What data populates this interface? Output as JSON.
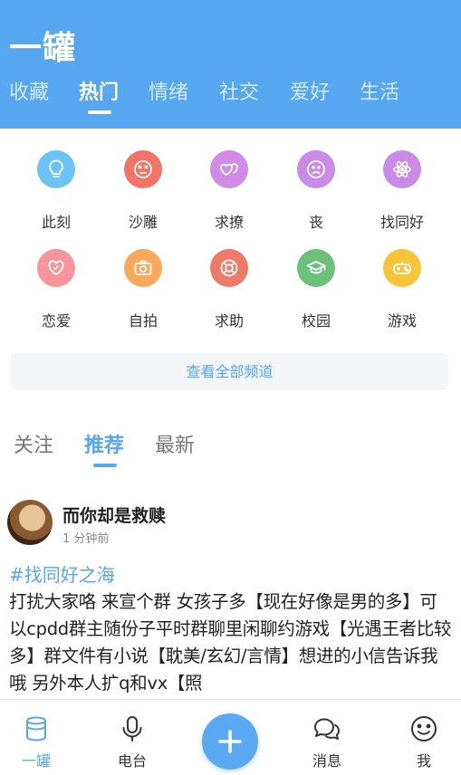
{
  "app": {
    "title": "一罐"
  },
  "top_tabs": [
    {
      "label": "收藏",
      "active": false
    },
    {
      "label": "热门",
      "active": true
    },
    {
      "label": "情绪",
      "active": false
    },
    {
      "label": "社交",
      "active": false
    },
    {
      "label": "爱好",
      "active": false
    },
    {
      "label": "生活",
      "active": false
    }
  ],
  "channels": [
    {
      "label": "此刻",
      "icon": "lightbulb-icon",
      "color": "#6cc3f5"
    },
    {
      "label": "沙雕",
      "icon": "dizzy-face-icon",
      "color": "#f17466"
    },
    {
      "label": "求撩",
      "icon": "hearts-icon",
      "color": "#d08ae8"
    },
    {
      "label": "丧",
      "icon": "sad-face-icon",
      "color": "#c98ae8"
    },
    {
      "label": "找同好",
      "icon": "atom-icon",
      "color": "#c98ae8"
    },
    {
      "label": "恋爱",
      "icon": "heart-icon",
      "color": "#f7959a"
    },
    {
      "label": "自拍",
      "icon": "camera-icon",
      "color": "#f8a95c"
    },
    {
      "label": "求助",
      "icon": "lifebuoy-icon",
      "color": "#f07a6a"
    },
    {
      "label": "校园",
      "icon": "graduation-cap-icon",
      "color": "#6cc179"
    },
    {
      "label": "游戏",
      "icon": "gamepad-icon",
      "color": "#f7c43a"
    }
  ],
  "view_all": "查看全部频道",
  "feed_tabs": [
    {
      "label": "关注",
      "active": false
    },
    {
      "label": "推荐",
      "active": true
    },
    {
      "label": "最新",
      "active": false
    }
  ],
  "post": {
    "author": "而你却是救赎",
    "time": "1 分钟前",
    "hashtag": "#找同好之海",
    "body": "打扰大家咯 来宣个群 女孩子多【现在好像是男的多】可以cpdd群主随份子平时群聊里闲聊约游戏【光遇王者比较多】群文件有小说【耽美/玄幻/言情】想进的小信告诉我哦 另外本人扩q和vx【照"
  },
  "bottom_nav": [
    {
      "label": "一罐",
      "icon": "jar-icon",
      "active": true
    },
    {
      "label": "电台",
      "icon": "microphone-icon",
      "active": false
    },
    {
      "label": "消息",
      "icon": "chat-bubbles-icon",
      "active": false
    },
    {
      "label": "我",
      "icon": "smiley-icon",
      "active": false
    }
  ],
  "colors": {
    "accent": "#56a6f0",
    "header_bg": "#56a6f0"
  }
}
